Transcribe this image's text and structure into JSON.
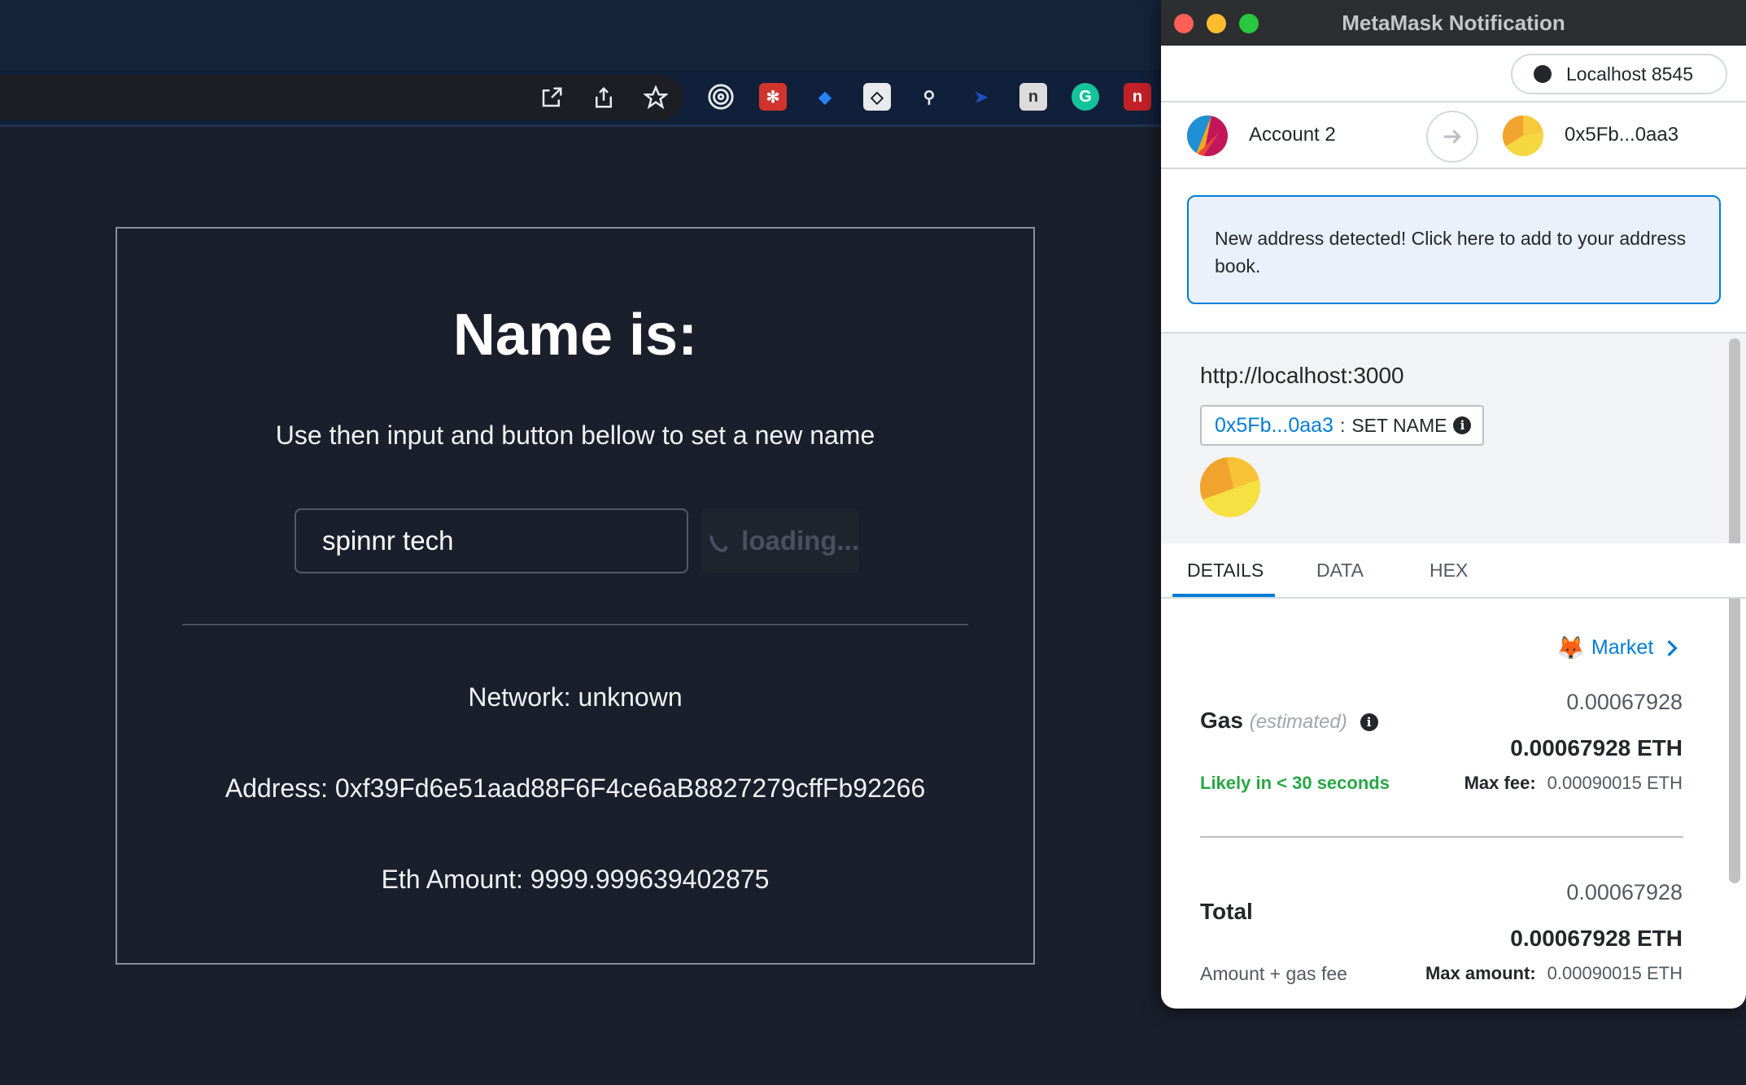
{
  "dapp": {
    "title": "Name is:",
    "subtitle": "Use then input and button bellow to set a new name",
    "input_value": "spinnr tech",
    "button_label": "loading...",
    "network": "Network: unknown",
    "address": "Address: 0xf39Fd6e51aad88F6F4ce6aB8827279cffFb92266",
    "eth_amount": "Eth Amount: 9999.999639402875"
  },
  "metamask": {
    "window_title": "MetaMask Notification",
    "network": "Localhost 8545",
    "from_account": "Account 2",
    "to_address": "0x5Fb...0aa3",
    "notice": "New address detected! Click here to add to your address book.",
    "origin": "http://localhost:3000",
    "method_address": "0x5Fb...0aa3",
    "method_separator": ":",
    "method_name": "SET NAME",
    "tabs": [
      {
        "label": "DETAILS",
        "active": true
      },
      {
        "label": "DATA",
        "active": false
      },
      {
        "label": "HEX",
        "active": false
      }
    ],
    "market_label": "Market",
    "gas": {
      "label": "Gas",
      "estimated": "(estimated)",
      "value": "0.00067928",
      "value_eth": "0.00067928 ETH",
      "likely": "Likely in < 30 seconds",
      "max_fee_label": "Max fee:",
      "max_fee_value": "0.00090015 ETH"
    },
    "total": {
      "label": "Total",
      "value": "0.00067928",
      "value_eth": "0.00067928 ETH",
      "sub_label": "Amount + gas fee",
      "max_amount_label": "Max amount:",
      "max_amount_value": "0.00090015 ETH"
    },
    "colors": {
      "accent": "#037dd6",
      "success": "#28a745"
    }
  }
}
